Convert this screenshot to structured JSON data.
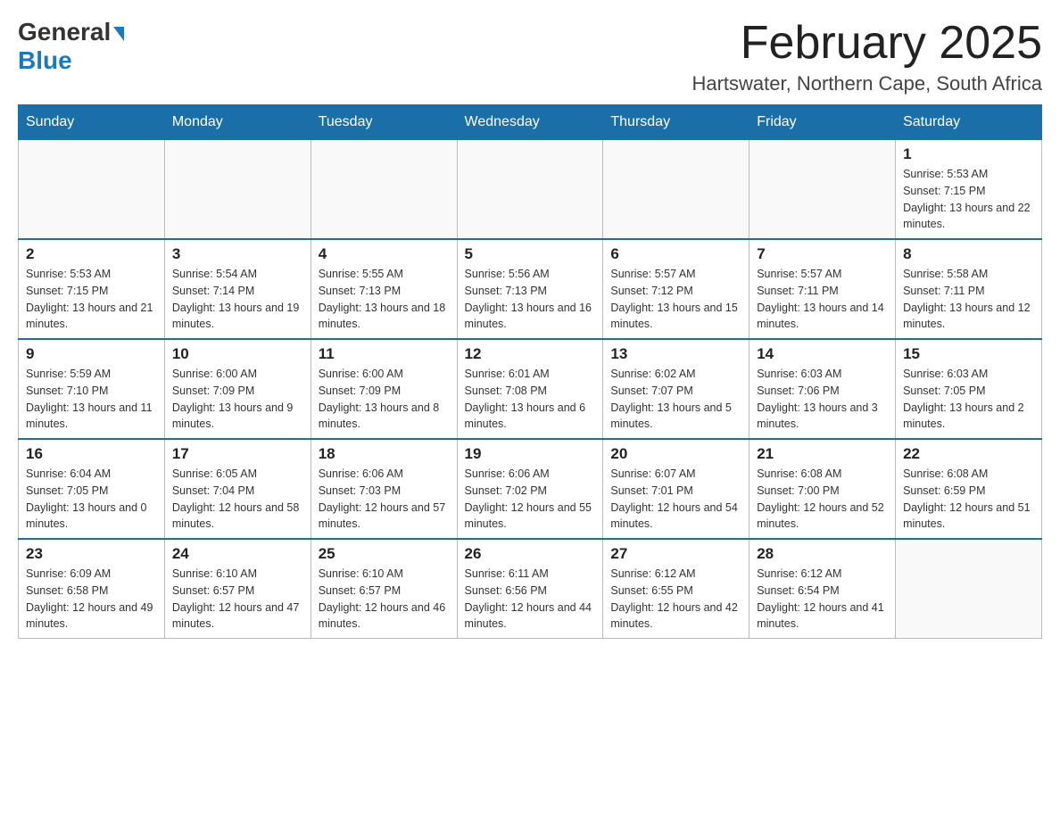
{
  "logo": {
    "general": "General",
    "blue": "Blue"
  },
  "header": {
    "month_year": "February 2025",
    "location": "Hartswater, Northern Cape, South Africa"
  },
  "days_of_week": [
    "Sunday",
    "Monday",
    "Tuesday",
    "Wednesday",
    "Thursday",
    "Friday",
    "Saturday"
  ],
  "weeks": [
    [
      {
        "day": "",
        "info": ""
      },
      {
        "day": "",
        "info": ""
      },
      {
        "day": "",
        "info": ""
      },
      {
        "day": "",
        "info": ""
      },
      {
        "day": "",
        "info": ""
      },
      {
        "day": "",
        "info": ""
      },
      {
        "day": "1",
        "info": "Sunrise: 5:53 AM\nSunset: 7:15 PM\nDaylight: 13 hours and 22 minutes."
      }
    ],
    [
      {
        "day": "2",
        "info": "Sunrise: 5:53 AM\nSunset: 7:15 PM\nDaylight: 13 hours and 21 minutes."
      },
      {
        "day": "3",
        "info": "Sunrise: 5:54 AM\nSunset: 7:14 PM\nDaylight: 13 hours and 19 minutes."
      },
      {
        "day": "4",
        "info": "Sunrise: 5:55 AM\nSunset: 7:13 PM\nDaylight: 13 hours and 18 minutes."
      },
      {
        "day": "5",
        "info": "Sunrise: 5:56 AM\nSunset: 7:13 PM\nDaylight: 13 hours and 16 minutes."
      },
      {
        "day": "6",
        "info": "Sunrise: 5:57 AM\nSunset: 7:12 PM\nDaylight: 13 hours and 15 minutes."
      },
      {
        "day": "7",
        "info": "Sunrise: 5:57 AM\nSunset: 7:11 PM\nDaylight: 13 hours and 14 minutes."
      },
      {
        "day": "8",
        "info": "Sunrise: 5:58 AM\nSunset: 7:11 PM\nDaylight: 13 hours and 12 minutes."
      }
    ],
    [
      {
        "day": "9",
        "info": "Sunrise: 5:59 AM\nSunset: 7:10 PM\nDaylight: 13 hours and 11 minutes."
      },
      {
        "day": "10",
        "info": "Sunrise: 6:00 AM\nSunset: 7:09 PM\nDaylight: 13 hours and 9 minutes."
      },
      {
        "day": "11",
        "info": "Sunrise: 6:00 AM\nSunset: 7:09 PM\nDaylight: 13 hours and 8 minutes."
      },
      {
        "day": "12",
        "info": "Sunrise: 6:01 AM\nSunset: 7:08 PM\nDaylight: 13 hours and 6 minutes."
      },
      {
        "day": "13",
        "info": "Sunrise: 6:02 AM\nSunset: 7:07 PM\nDaylight: 13 hours and 5 minutes."
      },
      {
        "day": "14",
        "info": "Sunrise: 6:03 AM\nSunset: 7:06 PM\nDaylight: 13 hours and 3 minutes."
      },
      {
        "day": "15",
        "info": "Sunrise: 6:03 AM\nSunset: 7:05 PM\nDaylight: 13 hours and 2 minutes."
      }
    ],
    [
      {
        "day": "16",
        "info": "Sunrise: 6:04 AM\nSunset: 7:05 PM\nDaylight: 13 hours and 0 minutes."
      },
      {
        "day": "17",
        "info": "Sunrise: 6:05 AM\nSunset: 7:04 PM\nDaylight: 12 hours and 58 minutes."
      },
      {
        "day": "18",
        "info": "Sunrise: 6:06 AM\nSunset: 7:03 PM\nDaylight: 12 hours and 57 minutes."
      },
      {
        "day": "19",
        "info": "Sunrise: 6:06 AM\nSunset: 7:02 PM\nDaylight: 12 hours and 55 minutes."
      },
      {
        "day": "20",
        "info": "Sunrise: 6:07 AM\nSunset: 7:01 PM\nDaylight: 12 hours and 54 minutes."
      },
      {
        "day": "21",
        "info": "Sunrise: 6:08 AM\nSunset: 7:00 PM\nDaylight: 12 hours and 52 minutes."
      },
      {
        "day": "22",
        "info": "Sunrise: 6:08 AM\nSunset: 6:59 PM\nDaylight: 12 hours and 51 minutes."
      }
    ],
    [
      {
        "day": "23",
        "info": "Sunrise: 6:09 AM\nSunset: 6:58 PM\nDaylight: 12 hours and 49 minutes."
      },
      {
        "day": "24",
        "info": "Sunrise: 6:10 AM\nSunset: 6:57 PM\nDaylight: 12 hours and 47 minutes."
      },
      {
        "day": "25",
        "info": "Sunrise: 6:10 AM\nSunset: 6:57 PM\nDaylight: 12 hours and 46 minutes."
      },
      {
        "day": "26",
        "info": "Sunrise: 6:11 AM\nSunset: 6:56 PM\nDaylight: 12 hours and 44 minutes."
      },
      {
        "day": "27",
        "info": "Sunrise: 6:12 AM\nSunset: 6:55 PM\nDaylight: 12 hours and 42 minutes."
      },
      {
        "day": "28",
        "info": "Sunrise: 6:12 AM\nSunset: 6:54 PM\nDaylight: 12 hours and 41 minutes."
      },
      {
        "day": "",
        "info": ""
      }
    ]
  ]
}
